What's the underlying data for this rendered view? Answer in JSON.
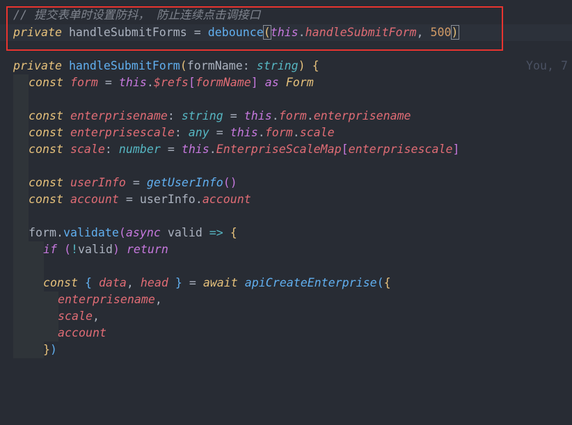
{
  "code": {
    "comment": "// 提交表单时设置防抖， 防止连续点击调接口",
    "l1": {
      "kw_private": "private",
      "name": "handleSubmitForms",
      "eq": " = ",
      "fn": "debounce",
      "paren_open": "(",
      "this": "this",
      "dot": ".",
      "member": "handleSubmitForm",
      "comma": ", ",
      "num": "500",
      "paren_close": ")"
    },
    "blame": "You, 7",
    "l3": {
      "kw_private": "private",
      "fn": "handleSubmitForm",
      "p1": "(",
      "param": "formName",
      "colon": ": ",
      "type": "string",
      "p2": ")",
      "brace": " {"
    },
    "l4": {
      "kw": "const",
      "v": "form",
      "eq": " = ",
      "this": "this",
      "dot": ".",
      "refs": "$refs",
      "b1": "[",
      "idx": "formName",
      "b2": "]",
      "as": " as ",
      "cls": "Form"
    },
    "l6": {
      "kw": "const",
      "v": "enterprisename",
      "colon": ": ",
      "type": "string",
      "eq": " = ",
      "this": "this",
      "d1": ".",
      "p1": "form",
      "d2": ".",
      "p2": "enterprisename"
    },
    "l7": {
      "kw": "const",
      "v": "enterprisescale",
      "colon": ": ",
      "type": "any",
      "eq": " = ",
      "this": "this",
      "d1": ".",
      "p1": "form",
      "d2": ".",
      "p2": "scale"
    },
    "l8": {
      "kw": "const",
      "v": "scale",
      "colon": ": ",
      "type": "number",
      "eq": " = ",
      "this": "this",
      "d1": ".",
      "p1": "EnterpriseScaleMap",
      "b1": "[",
      "idx": "enterprisescale",
      "b2": "]"
    },
    "l10": {
      "kw": "const",
      "v": "userInfo",
      "eq": " = ",
      "fn": "getUserInfo",
      "call": "()"
    },
    "l11": {
      "kw": "const",
      "v": "account",
      "eq": " = ",
      "obj": "userInfo",
      "dot": ".",
      "prop": "account"
    },
    "l13": {
      "obj": "form",
      "dot": ".",
      "fn": "validate",
      "p1": "(",
      "async": "async",
      "sp": " ",
      "param": "valid",
      "arrow": " => ",
      "brace": "{"
    },
    "l14": {
      "kw": "if",
      "sp": " ",
      "p1": "(",
      "bang": "!",
      "v": "valid",
      "p2": ")",
      "ret": " return"
    },
    "l16": {
      "kw": "const",
      "b1": " { ",
      "a": "data",
      "c": ", ",
      "b": "head",
      "b2": " }",
      "eq": " = ",
      "await": "await",
      "sp": " ",
      "fn": "apiCreateEnterprise",
      "p1": "(",
      "br": "{"
    },
    "l17": {
      "v": "enterprisename",
      "c": ","
    },
    "l18": {
      "v": "scale",
      "c": ","
    },
    "l19": {
      "v": "account"
    },
    "l20": {
      "br": "}",
      "p": ")"
    }
  },
  "colors": {
    "background": "#282c34",
    "highlight_box": "#e8342f"
  }
}
